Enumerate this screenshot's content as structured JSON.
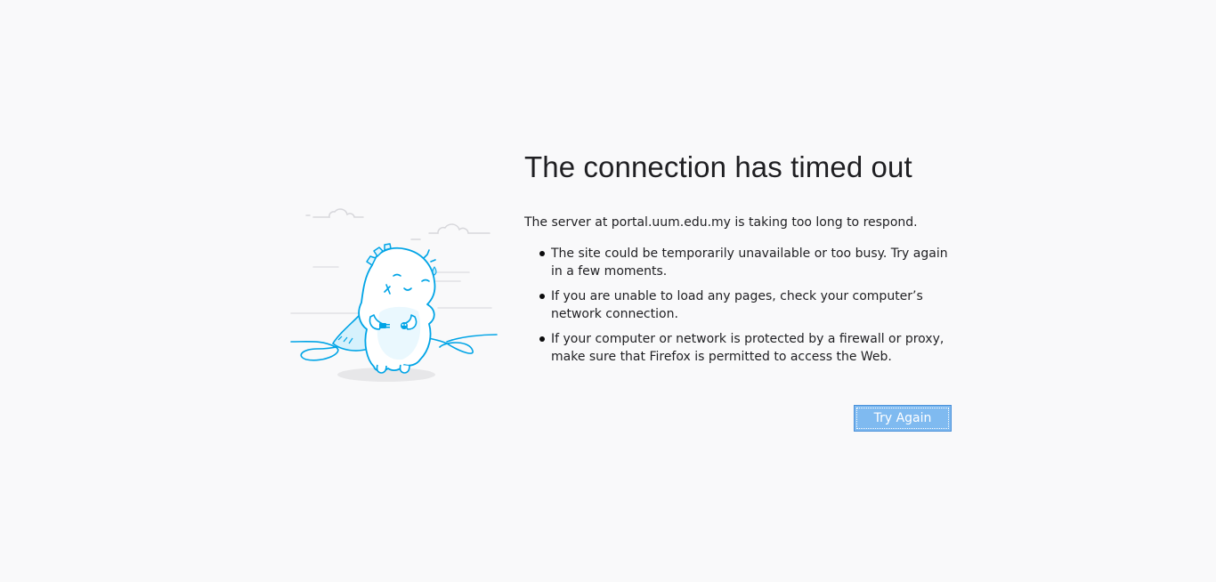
{
  "error": {
    "title": "The connection has timed out",
    "description": "The server at portal.uum.edu.my is taking too long to respond.",
    "suggestions": [
      "The site could be temporarily unavailable or too busy. Try again in a few moments.",
      "If you are unable to load any pages, check your computer’s network connection.",
      "If your computer or network is protected by a firewall or proxy, make sure that Firefox is permitted to access the Web."
    ],
    "try_again_label": "Try Again"
  },
  "icons": {
    "illustration": "dino-unplugged-cable-illustration"
  },
  "colors": {
    "background": "#f9f9fa",
    "button": "#7fbaf0",
    "illustration_stroke": "#00a4e6"
  }
}
